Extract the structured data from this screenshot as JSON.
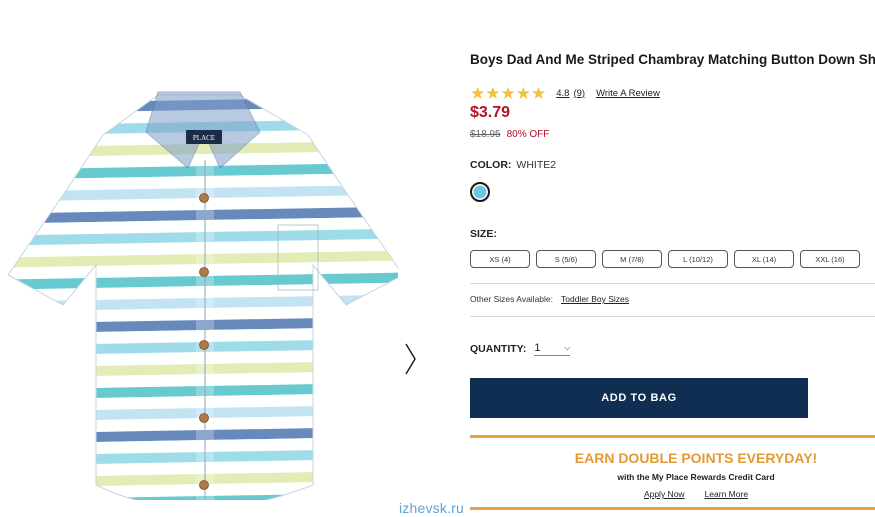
{
  "product": {
    "title": "Boys Dad And Me Striped Chambray Matching Button Down Sh",
    "rating_value": "4.8",
    "rating_count": "(9)",
    "stars": 4.8,
    "write_review": "Write A Review",
    "price": "$3.79",
    "old_price": "$18.95",
    "discount": "80% OFF"
  },
  "color": {
    "label": "COLOR:",
    "value": "WHITE2",
    "swatch_color": "#6fc6dc"
  },
  "size": {
    "label": "SIZE:",
    "options": [
      "XS (4)",
      "S (5/6)",
      "M (7/8)",
      "L (10/12)",
      "XL (14)",
      "XXL (16)"
    ],
    "other_sizes_label": "Other Sizes Available:",
    "other_sizes_link": "Toddler Boy Sizes"
  },
  "quantity": {
    "label": "QUANTITY:",
    "value": "1"
  },
  "cta": {
    "add_to_bag": "ADD TO BAG"
  },
  "promo": {
    "title": "EARN DOUBLE POINTS EVERYDAY!",
    "subtitle": "with the My Place Rewards Credit Card",
    "apply": "Apply Now",
    "learn": "Learn More"
  },
  "image": {
    "label_text": "PLACE",
    "watermark": "izhevsk.ru",
    "next_icon": "chevron-right-icon"
  },
  "colors": {
    "brand_navy": "#0f2e52",
    "price_red": "#b3132b",
    "promo_orange": "#e39a34",
    "star_yellow": "#f3c13a"
  }
}
